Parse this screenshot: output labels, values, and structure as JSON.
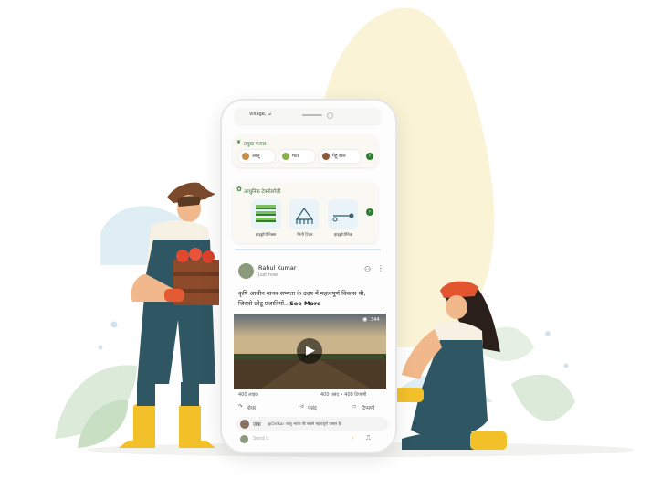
{
  "phone": {
    "location": "Village, G",
    "crops_title": "प्रमुख फसल",
    "crops": [
      "आलू",
      "मटर",
      "गेहूं बाल"
    ],
    "tech_title": "आधुनिक टेक्नोलॉजी",
    "tech": [
      "हाइड्रोपोनिक्स",
      "मिनी टिलर",
      "हाइड्रोपोनिक"
    ],
    "post": {
      "author": "Rahul Kumar",
      "time": "Just now",
      "text_line1": "कृषि आसीन मानव सभ्यता के उदय में महत्वपूर्ण विकास थी,",
      "text_line2": "जिससे छोटू प्रजातियों...",
      "see_more": "See More",
      "views": "344",
      "likes_left": "400 लाइक",
      "likes_right": "400 पसंद • 400 टिप्पणी",
      "action_share": "शेयर",
      "action_like": "पसंद",
      "action_comment": "टिप्पणी",
      "comment_user": "जया",
      "comment_text": "@Omkar आलू भारत की सबसे महत्वपूर्ण फसल है।",
      "reply_placeholder": "Send it"
    }
  },
  "colors": {
    "accent_green": "#2e7d32",
    "bg_blob": "#fbf3d6",
    "overalls": "#2f5763",
    "boots": "#f2c12a"
  }
}
